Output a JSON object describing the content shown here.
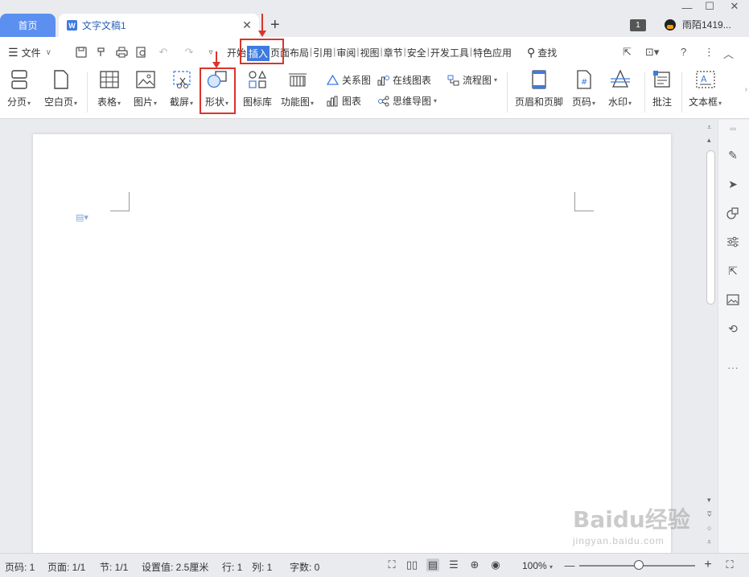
{
  "tabs": {
    "home": "首页",
    "document": "文字文稿1"
  },
  "window": {
    "badge": "1",
    "user": "雨陌1419..."
  },
  "menu": {
    "file": "文件",
    "tabs": [
      "开始",
      "插入",
      "页面布局",
      "引用",
      "审阅",
      "视图",
      "章节",
      "安全",
      "开发工具",
      "特色应用"
    ],
    "active_tab": "插入",
    "search": "查找"
  },
  "ribbon": {
    "page_break": "分页",
    "blank_page": "空白页",
    "table": "表格",
    "picture": "图片",
    "screenshot": "截屏",
    "shape": "形状",
    "icon_library": "图标库",
    "function_chart": "功能图",
    "relation_chart": "关系图",
    "online_chart": "在线图表",
    "flowchart": "流程图",
    "chart": "图表",
    "mind_map": "思维导图",
    "header_footer": "页眉和页脚",
    "page_number": "页码",
    "watermark": "水印",
    "comment": "批注",
    "text_box": "文本框"
  },
  "statusbar": {
    "page_num": "页码: 1",
    "pages": "页面: 1/1",
    "section": "节: 1/1",
    "setting": "设置值: 2.5厘米",
    "row": "行: 1",
    "col": "列: 1",
    "words": "字数: 0",
    "zoom": "100%"
  },
  "watermark": {
    "brand": "Baidu经验",
    "url": "jingyan.baidu.com"
  },
  "colors": {
    "accent": "#3d7be0",
    "home_tab": "#5b8ff0",
    "highlight": "#d9342b"
  }
}
